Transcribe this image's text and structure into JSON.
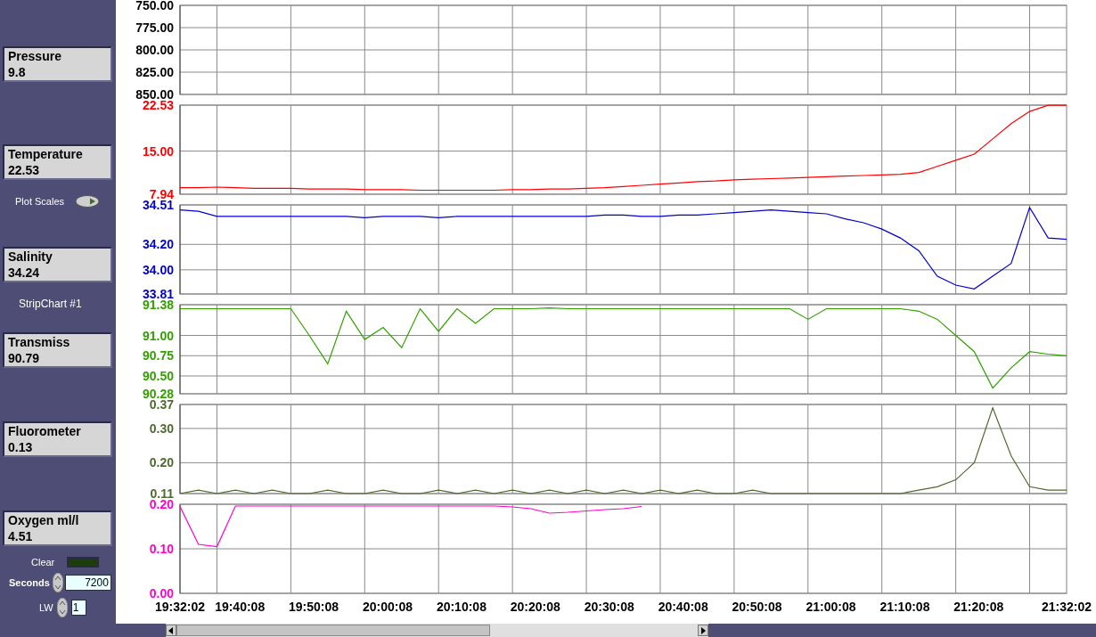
{
  "indicators": [
    {
      "label": "Pressure",
      "value": "9.8"
    },
    {
      "label": "Temperature",
      "value": "22.53"
    },
    {
      "label": "Salinity",
      "value": "34.24"
    },
    {
      "label": "Transmiss",
      "value": "90.79"
    },
    {
      "label": "Fluorometer",
      "value": "0.13"
    },
    {
      "label": "Oxygen ml/l",
      "value": "4.51"
    }
  ],
  "plot_scales": {
    "label": "Plot Scales"
  },
  "chart_label": "StripChart #1",
  "clear": {
    "label": "Clear",
    "lit": false
  },
  "seconds": {
    "label": "Seconds",
    "value": "7200"
  },
  "lw": {
    "label": "LW",
    "value": "1"
  },
  "charts": [
    {
      "chart_data": {
        "type": "line",
        "xlim": [
          70322,
          77522
        ],
        "ylim": [
          850,
          750
        ],
        "grid": true,
        "yticks": [
          {
            "value": 750,
            "label": "750.00"
          },
          {
            "value": 775,
            "label": "775.00"
          },
          {
            "value": 800,
            "label": "800.00"
          },
          {
            "value": 825,
            "label": "825.00"
          },
          {
            "value": 850,
            "label": "850.00"
          }
        ]
      }
    },
    {
      "chart_data": {
        "type": "line",
        "xlim": [
          70322,
          77522
        ],
        "ylim": [
          7.94,
          22.53
        ],
        "grid": true,
        "yticks": [
          {
            "value": 7.94,
            "label": "7.94"
          },
          {
            "value": 15,
            "label": "15.00"
          },
          {
            "value": 22.53,
            "label": "22.53"
          }
        ],
        "x": [
          70322,
          70472,
          70622,
          70772,
          70922,
          71072,
          71222,
          71372,
          71522,
          71672,
          71822,
          71972,
          72122,
          72272,
          72422,
          72572,
          72722,
          72872,
          73022,
          73172,
          73322,
          73472,
          73622,
          73772,
          73922,
          74072,
          74222,
          74372,
          74522,
          74672,
          74822,
          74972,
          75122,
          75272,
          75422,
          75572,
          75722,
          75872,
          76022,
          76172,
          76322,
          76472,
          76622,
          76772,
          76922,
          77072,
          77222,
          77372,
          77522
        ],
        "series": [
          {
            "color": "#ff0000",
            "values": [
              9.0,
              9.0,
              9.1,
              9.0,
              8.9,
              8.9,
              8.9,
              8.8,
              8.8,
              8.8,
              8.7,
              8.7,
              8.7,
              8.6,
              8.6,
              8.6,
              8.6,
              8.6,
              8.7,
              8.7,
              8.8,
              8.8,
              8.9,
              9.0,
              9.2,
              9.4,
              9.6,
              9.8,
              10.0,
              10.1,
              10.3,
              10.4,
              10.5,
              10.6,
              10.7,
              10.8,
              10.9,
              11.0,
              11.1,
              11.2,
              11.5,
              12.5,
              13.5,
              14.5,
              17,
              19.5,
              21.5,
              22.5,
              22.5
            ]
          }
        ]
      }
    },
    {
      "chart_data": {
        "type": "line",
        "xlim": [
          70322,
          77522
        ],
        "ylim": [
          33.81,
          34.51
        ],
        "grid": true,
        "yticks": [
          {
            "value": 33.81,
            "label": "33.81"
          },
          {
            "value": 34,
            "label": "34.00"
          },
          {
            "value": 34.2,
            "label": "34.20"
          },
          {
            "value": 34.51,
            "label": "34.51"
          }
        ],
        "x": [
          70322,
          70472,
          70622,
          70772,
          70922,
          71072,
          71222,
          71372,
          71522,
          71672,
          71822,
          71972,
          72122,
          72272,
          72422,
          72572,
          72722,
          72872,
          73022,
          73172,
          73322,
          73472,
          73622,
          73772,
          73922,
          74072,
          74222,
          74372,
          74522,
          74672,
          74822,
          74972,
          75122,
          75272,
          75422,
          75572,
          75722,
          75872,
          76022,
          76172,
          76322,
          76472,
          76622,
          76772,
          76922,
          77072,
          77222,
          77372,
          77522
        ],
        "series": [
          {
            "color": "#0000cc",
            "values": [
              34.47,
              34.46,
              34.42,
              34.42,
              34.42,
              34.42,
              34.42,
              34.42,
              34.42,
              34.42,
              34.41,
              34.42,
              34.42,
              34.42,
              34.41,
              34.42,
              34.42,
              34.42,
              34.42,
              34.42,
              34.42,
              34.42,
              34.42,
              34.43,
              34.43,
              34.42,
              34.42,
              34.43,
              34.43,
              34.44,
              34.45,
              34.46,
              34.47,
              34.46,
              34.45,
              34.44,
              34.4,
              34.37,
              34.32,
              34.25,
              34.15,
              33.95,
              33.88,
              33.85,
              33.95,
              34.05,
              34.49,
              34.25,
              34.24
            ]
          }
        ]
      }
    },
    {
      "chart_data": {
        "type": "line",
        "xlim": [
          70322,
          77522
        ],
        "ylim": [
          90.28,
          91.38
        ],
        "grid": true,
        "yticks": [
          {
            "value": 90.28,
            "label": "90.28"
          },
          {
            "value": 90.5,
            "label": "90.50"
          },
          {
            "value": 90.75,
            "label": "90.75"
          },
          {
            "value": 91,
            "label": "91.00"
          },
          {
            "value": 91.38,
            "label": "91.38"
          }
        ],
        "x": [
          70322,
          70472,
          70622,
          70772,
          70922,
          71072,
          71222,
          71372,
          71522,
          71672,
          71822,
          71972,
          72122,
          72272,
          72422,
          72572,
          72722,
          72872,
          73022,
          73172,
          73322,
          73472,
          73622,
          73772,
          73922,
          74072,
          74222,
          74372,
          74522,
          74672,
          74822,
          74972,
          75122,
          75272,
          75422,
          75572,
          75722,
          75872,
          76022,
          76172,
          76322,
          76472,
          76622,
          76772,
          76922,
          77072,
          77222,
          77372,
          77522
        ],
        "series": [
          {
            "color": "#33a000",
            "values": [
              91.33,
              91.33,
              91.33,
              91.33,
              91.33,
              91.33,
              91.33,
              91.0,
              90.65,
              91.3,
              90.95,
              91.1,
              90.85,
              91.33,
              91.05,
              91.33,
              91.15,
              91.33,
              91.33,
              91.33,
              91.34,
              91.33,
              91.33,
              91.33,
              91.33,
              91.33,
              91.33,
              91.33,
              91.33,
              91.33,
              91.33,
              91.33,
              91.33,
              91.33,
              91.2,
              91.33,
              91.33,
              91.33,
              91.33,
              91.33,
              91.3,
              91.2,
              91.0,
              90.8,
              90.35,
              90.6,
              90.8,
              90.77,
              90.75
            ]
          }
        ]
      }
    },
    {
      "chart_data": {
        "type": "line",
        "xlim": [
          70322,
          77522
        ],
        "ylim": [
          0.11,
          0.37
        ],
        "grid": true,
        "yticks": [
          {
            "value": 0.11,
            "label": "0.11"
          },
          {
            "value": 0.2,
            "label": "0.20"
          },
          {
            "value": 0.3,
            "label": "0.30"
          },
          {
            "value": 0.37,
            "label": "0.37"
          }
        ],
        "x": [
          70322,
          70472,
          70622,
          70772,
          70922,
          71072,
          71222,
          71372,
          71522,
          71672,
          71822,
          71972,
          72122,
          72272,
          72422,
          72572,
          72722,
          72872,
          73022,
          73172,
          73322,
          73472,
          73622,
          73772,
          73922,
          74072,
          74222,
          74372,
          74522,
          74672,
          74822,
          74972,
          75122,
          75272,
          75422,
          75572,
          75722,
          75872,
          76022,
          76172,
          76322,
          76472,
          76622,
          76772,
          76922,
          77072,
          77222,
          77372,
          77522
        ],
        "series": [
          {
            "color": "#4f6a2f",
            "values": [
              0.11,
              0.12,
              0.11,
              0.12,
              0.11,
              0.12,
              0.11,
              0.11,
              0.12,
              0.11,
              0.11,
              0.12,
              0.11,
              0.11,
              0.12,
              0.11,
              0.12,
              0.11,
              0.12,
              0.11,
              0.12,
              0.11,
              0.12,
              0.11,
              0.12,
              0.11,
              0.12,
              0.11,
              0.12,
              0.11,
              0.11,
              0.12,
              0.11,
              0.11,
              0.11,
              0.11,
              0.11,
              0.11,
              0.11,
              0.11,
              0.12,
              0.13,
              0.15,
              0.2,
              0.36,
              0.22,
              0.13,
              0.12,
              0.12
            ]
          }
        ]
      }
    },
    {
      "chart_data": {
        "type": "line",
        "xlim": [
          70322,
          77522
        ],
        "ylim": [
          0,
          0.2
        ],
        "grid": true,
        "yticks": [
          {
            "value": 0,
            "label": "0.00"
          },
          {
            "value": 0.1,
            "label": "0.10"
          },
          {
            "value": 0.2,
            "label": "0.20"
          }
        ],
        "x": [
          70322,
          70472,
          70622,
          70772,
          70922,
          71072,
          71222,
          71372,
          71522,
          71672,
          71822,
          71972,
          72122,
          72272,
          72422,
          72572,
          72722,
          72872,
          73022,
          73172,
          73322,
          73472,
          73622,
          73772,
          73922,
          74072
        ],
        "xticks": [
          {
            "value": 70322,
            "label": "19:32:02"
          },
          {
            "value": 70808,
            "label": "19:40:08"
          },
          {
            "value": 71408,
            "label": "19:50:08"
          },
          {
            "value": 72008,
            "label": "20:00:08"
          },
          {
            "value": 72608,
            "label": "20:10:08"
          },
          {
            "value": 73208,
            "label": "20:20:08"
          },
          {
            "value": 73808,
            "label": "20:30:08"
          },
          {
            "value": 74408,
            "label": "20:40:08"
          },
          {
            "value": 75008,
            "label": "20:50:08"
          },
          {
            "value": 75608,
            "label": "21:00:08"
          },
          {
            "value": 76208,
            "label": "21:10:08"
          },
          {
            "value": 76808,
            "label": "21:20:08"
          },
          {
            "value": 77522,
            "label": "21:32:02"
          }
        ],
        "series": [
          {
            "color": "#ff00cc",
            "values": [
              0.195,
              0.11,
              0.105,
              0.196,
              0.196,
              0.196,
              0.196,
              0.196,
              0.196,
              0.196,
              0.196,
              0.196,
              0.196,
              0.196,
              0.196,
              0.196,
              0.196,
              0.196,
              0.194,
              0.19,
              0.18,
              0.182,
              0.185,
              0.188,
              0.19,
              0.195
            ]
          }
        ]
      }
    }
  ]
}
